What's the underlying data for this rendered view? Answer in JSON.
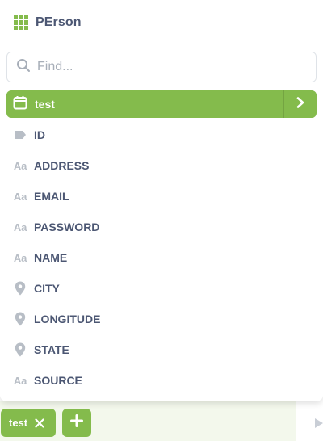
{
  "header": {
    "title": "PErson",
    "icon": "table-grid-icon"
  },
  "search": {
    "placeholder": "Find...",
    "value": ""
  },
  "selected": {
    "label": "test",
    "icon": "calendar-icon",
    "expand_icon": "chevron-right-icon"
  },
  "fields": [
    {
      "label": "ID",
      "icon": "tag-icon"
    },
    {
      "label": "ADDRESS",
      "icon": "text-icon",
      "glyph": "Aa"
    },
    {
      "label": "EMAIL",
      "icon": "text-icon",
      "glyph": "Aa"
    },
    {
      "label": "PASSWORD",
      "icon": "text-icon",
      "glyph": "Aa"
    },
    {
      "label": "NAME",
      "icon": "text-icon",
      "glyph": "Aa"
    },
    {
      "label": "CITY",
      "icon": "location-pin-icon"
    },
    {
      "label": "LONGITUDE",
      "icon": "location-pin-icon"
    },
    {
      "label": "STATE",
      "icon": "location-pin-icon"
    },
    {
      "label": "SOURCE",
      "icon": "text-icon",
      "glyph": "Aa"
    }
  ],
  "footer": {
    "chip_label": "test",
    "add_icon": "plus-icon",
    "remove_icon": "close-icon"
  },
  "colors": {
    "accent": "#84bb4c",
    "text": "#4c5773",
    "muted_icon": "#b8bec6",
    "footer_bg": "#f3f8ec"
  }
}
